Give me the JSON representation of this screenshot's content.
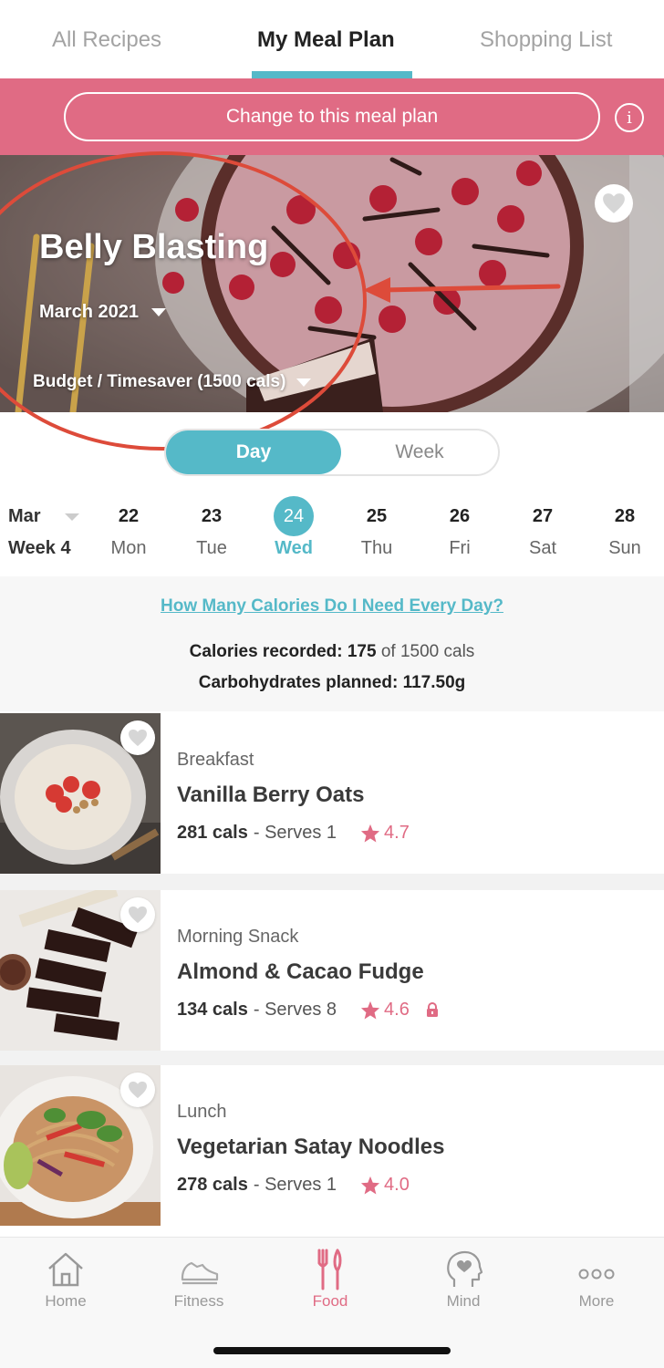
{
  "top_tabs": [
    {
      "label": "All Recipes"
    },
    {
      "label": "My Meal Plan"
    },
    {
      "label": "Shopping List"
    }
  ],
  "banner": {
    "change_label": "Change to this meal plan",
    "info_icon": "info-icon"
  },
  "hero": {
    "title": "Belly Blasting",
    "month": "March 2021",
    "plan": "Budget / Timesaver (1500 cals)"
  },
  "toggle": {
    "day": "Day",
    "week": "Week"
  },
  "week": {
    "month": "Mar",
    "week": "Week 4",
    "days": [
      {
        "num": "22",
        "name": "Mon"
      },
      {
        "num": "23",
        "name": "Tue"
      },
      {
        "num": "24",
        "name": "Wed"
      },
      {
        "num": "25",
        "name": "Thu"
      },
      {
        "num": "26",
        "name": "Fri"
      },
      {
        "num": "27",
        "name": "Sat"
      },
      {
        "num": "28",
        "name": "Sun"
      }
    ],
    "selected": "24"
  },
  "summary": {
    "link": "How Many Calories Do I Need Every Day?",
    "cal_label": "Calories recorded:",
    "cal_value": "175",
    "cal_suffix": "of 1500 cals",
    "carb_text": "Carbohydrates planned: 117.50g"
  },
  "meals": [
    {
      "type": "Breakfast",
      "name": "Vanilla Berry Oats",
      "cals": "281 cals",
      "serves": "- Serves 1",
      "rating": "4.7",
      "locked": false
    },
    {
      "type": "Morning Snack",
      "name": "Almond & Cacao Fudge",
      "cals": "134 cals",
      "serves": "- Serves 8",
      "rating": "4.6",
      "locked": true
    },
    {
      "type": "Lunch",
      "name": "Vegetarian Satay Noodles",
      "cals": "278 cals",
      "serves": "- Serves 1",
      "rating": "4.0",
      "locked": false
    }
  ],
  "bottom_nav": [
    {
      "label": "Home",
      "icon": "home-icon"
    },
    {
      "label": "Fitness",
      "icon": "shoe-icon"
    },
    {
      "label": "Food",
      "icon": "fork-knife-icon"
    },
    {
      "label": "Mind",
      "icon": "head-heart-icon"
    },
    {
      "label": "More",
      "icon": "more-icon"
    }
  ],
  "colors": {
    "accent_teal": "#55b9c8",
    "accent_pink": "#e06b84",
    "annotation_red": "#dd4b3a"
  }
}
